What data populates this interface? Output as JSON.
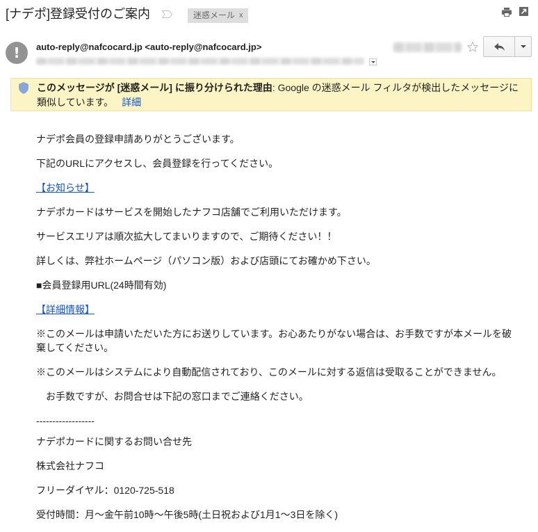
{
  "subject": "[ナデポ]登録受付のご案内",
  "label_chip": {
    "name": "迷惑メール",
    "remove": "x"
  },
  "header_icons": {
    "importance": "importance-marker-icon",
    "print": "print-icon",
    "new_window": "open-in-new-window-icon"
  },
  "sender": {
    "avatar_symbol": "!",
    "from": "auto-reply@nafcocard.jp <auto-reply@nafcocard.jp>"
  },
  "message_actions": {
    "star": "star-icon",
    "reply": "reply-icon",
    "more": "chevron-down-icon",
    "details": "chevron-down-icon"
  },
  "spam_banner": {
    "icon": "shield-icon",
    "reason_bold": "このメッセージが [迷惑メール] に振り分けられた理由",
    "reason_text": ": Google の迷惑メール フィルタが検出したメッセージに類似しています。",
    "details_link": "詳細"
  },
  "message_body": [
    {
      "text": "ナデポ会員の登録申請ありがとうございます。",
      "link": false
    },
    {
      "text": "下記のURLにアクセスし、会員登録を行ってください。",
      "link": false
    },
    {
      "text": "【お知らせ】",
      "link": true
    },
    {
      "text": "ナデポカードはサービスを開始したナフコ店舗でご利用いただけます。",
      "link": false
    },
    {
      "text": "サービスエリアは順次拡大してまいりますので、ご期待ください！！",
      "link": false
    },
    {
      "text": "詳しくは、弊社ホームページ（パソコン版）および店頭にてお確かめ下さい。",
      "link": false
    },
    {
      "text": "■会員登録用URL(24時間有効)",
      "link": false
    },
    {
      "text": "【詳細情報】",
      "link": true
    },
    {
      "text": "※このメールは申請いただいた方にお送りしています。お心あたりがない場合は、お手数ですが本メールを破棄してください。",
      "link": false
    },
    {
      "text": "※このメールはシステムにより自動配信されており、このメールに対する返信は受取ることができません。",
      "link": false
    },
    {
      "text": "　お手数ですが、お問合せは下記の窓口までご連絡ください。",
      "link": false
    },
    {
      "text": "------------------",
      "link": false
    },
    {
      "text": "ナデポカードに関するお問い合せ先",
      "link": false
    },
    {
      "text": "株式会社ナフコ",
      "link": false
    },
    {
      "text": "フリーダイヤル：0120-725-518",
      "link": false
    },
    {
      "text": "受付時間：月～金午前10時～午後5時(土日祝および1月1～3日を除く)",
      "link": false
    }
  ],
  "colors": {
    "text": "#222222",
    "link": "#1155cc",
    "banner_background": "#fcf4c4",
    "banner_border": "#f0e19c",
    "label_chip_background": "#dddddd",
    "avatar_background": "#939393",
    "shield": "#8aa6d8"
  }
}
